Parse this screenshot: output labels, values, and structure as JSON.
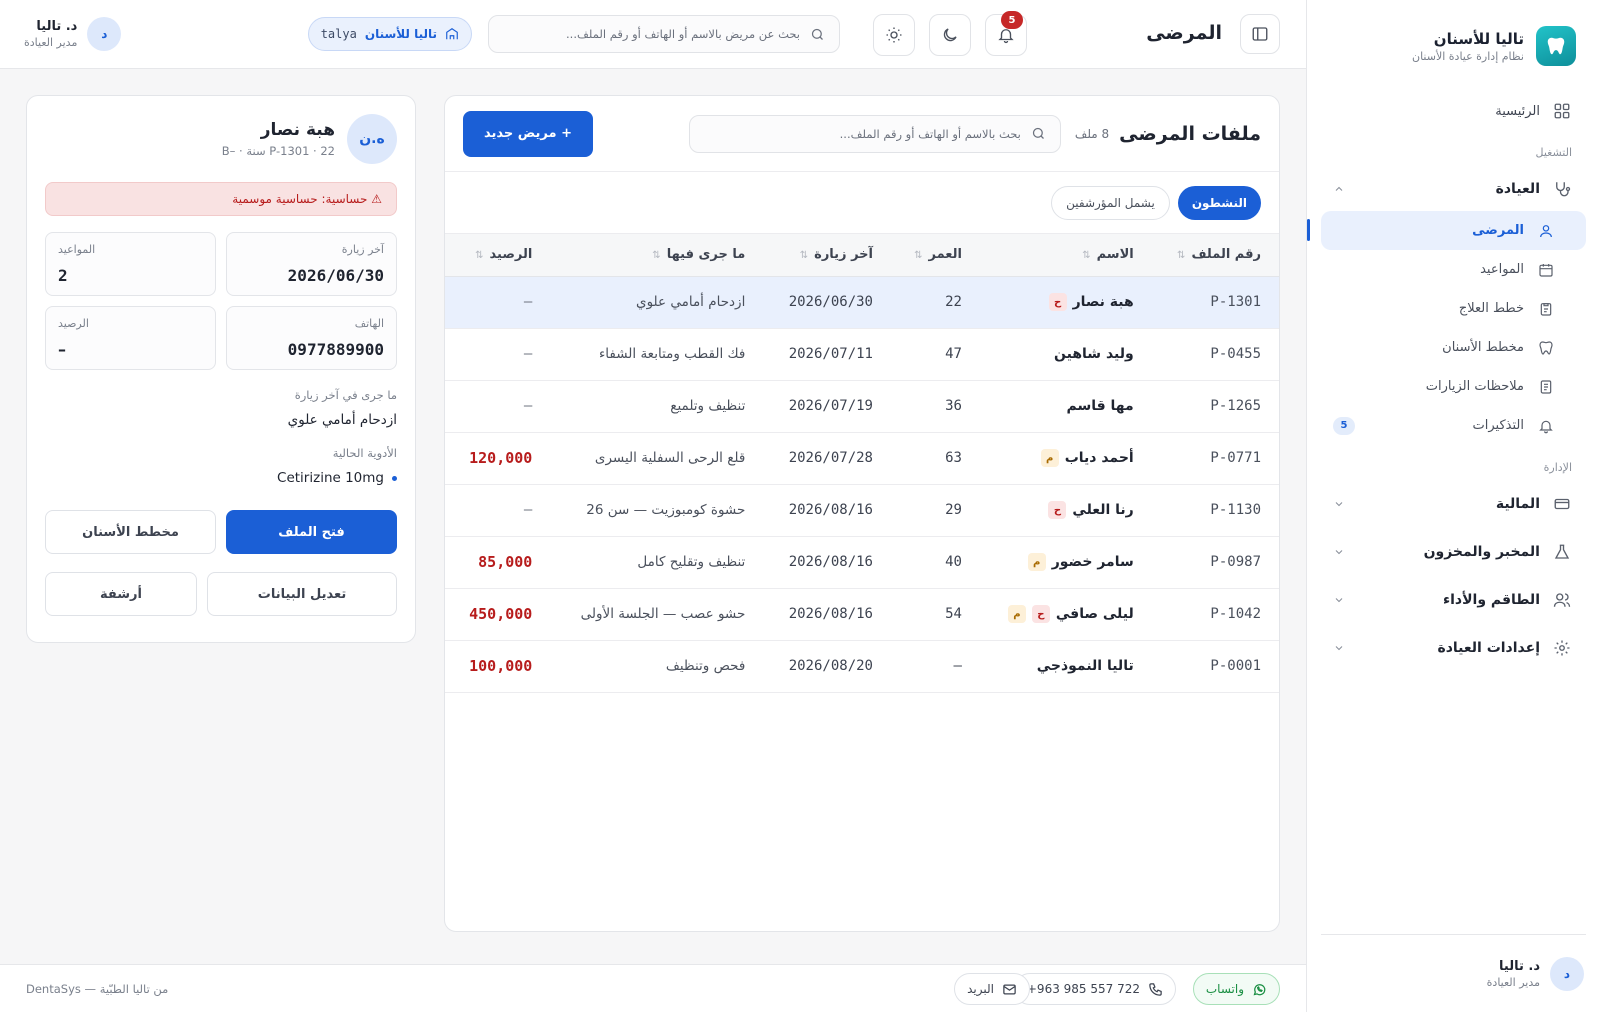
{
  "sidebar": {
    "brand_name": "تاليا للأسنان",
    "brand_sub": "نظام إدارة عيادة الأسنان",
    "home": "الرئيسية",
    "section_ops": "التشغيل",
    "clinic_group": "العيادة",
    "items": [
      {
        "label": "المرضى"
      },
      {
        "label": "المواعيد"
      },
      {
        "label": "خطط العلاج"
      },
      {
        "label": "مخطط الأسنان"
      },
      {
        "label": "ملاحظات الزيارات"
      },
      {
        "label": "التذكيرات",
        "badge": "5"
      }
    ],
    "section_admin": "الإدارة",
    "admin_groups": [
      {
        "label": "المالية"
      },
      {
        "label": "المخبر والمخزون"
      },
      {
        "label": "الطاقم والأداء"
      },
      {
        "label": "إعدادات العيادة"
      }
    ],
    "user": {
      "initial": "د",
      "name": "د. تاليا",
      "role": "مدير العيادة"
    }
  },
  "topbar": {
    "title": "المرضى",
    "search_placeholder": "بحث عن مريض بالاسم أو الهاتف أو رقم الملف...",
    "clinic_name": "تاليا للأسنان",
    "clinic_code": "talya",
    "notif_count": "5",
    "user": {
      "initial": "د",
      "name": "د. تاليا",
      "role": "مدير العيادة"
    }
  },
  "patients": {
    "title": "ملفات المرضى",
    "count": "8 ملف",
    "search_placeholder": "بحث بالاسم أو الهاتف أو رقم الملف...",
    "new_button": "+ مريض جديد",
    "filter_active": "النشطون",
    "filter_archived": "يشمل المؤرشفين",
    "columns": {
      "file": "رقم الملف",
      "name": "الاسم",
      "age": "العمر",
      "last_visit": "آخر زيارة",
      "procedure": "ما جرى فيها",
      "balance": "الرصيد"
    },
    "rows": [
      {
        "file": "P-1301",
        "name": "هبة نصار",
        "tags": [
          {
            "t": "ح",
            "c": "red"
          }
        ],
        "age": "22",
        "last_visit": "2026/06/30",
        "procedure": "ازدحام أمامي علوي",
        "balance": "—"
      },
      {
        "file": "P-0455",
        "name": "وليد شاهين",
        "tags": [],
        "age": "47",
        "last_visit": "2026/07/11",
        "procedure": "فك القطب ومتابعة الشفاء",
        "balance": "—"
      },
      {
        "file": "P-1265",
        "name": "مها قاسم",
        "tags": [],
        "age": "36",
        "last_visit": "2026/07/19",
        "procedure": "تنظيف وتلميع",
        "balance": "—"
      },
      {
        "file": "P-0771",
        "name": "أحمد دياب",
        "tags": [
          {
            "t": "م",
            "c": "amber"
          }
        ],
        "age": "63",
        "last_visit": "2026/07/28",
        "procedure": "قلع الرحى السفلية اليسرى",
        "balance": "120,000"
      },
      {
        "file": "P-1130",
        "name": "رنا العلي",
        "tags": [
          {
            "t": "ح",
            "c": "red"
          }
        ],
        "age": "29",
        "last_visit": "2026/08/16",
        "procedure": "حشوة كومبوزيت — سن 26",
        "balance": "—"
      },
      {
        "file": "P-0987",
        "name": "سامر خضور",
        "tags": [
          {
            "t": "م",
            "c": "amber"
          }
        ],
        "age": "40",
        "last_visit": "2026/08/16",
        "procedure": "تنظيف وتقليح كامل",
        "balance": "85,000"
      },
      {
        "file": "P-1042",
        "name": "ليلى صافي",
        "tags": [
          {
            "t": "ح",
            "c": "red"
          },
          {
            "t": "م",
            "c": "amber"
          }
        ],
        "age": "54",
        "last_visit": "2026/08/16",
        "procedure": "حشو عصب — الجلسة الأولى",
        "balance": "450,000"
      },
      {
        "file": "P-0001",
        "name": "تاليا النموذجي",
        "tags": [],
        "age": "—",
        "last_visit": "2026/08/20",
        "procedure": "فحص وتنظيف",
        "balance": "100,000"
      }
    ]
  },
  "detail": {
    "initials": "ه.ن",
    "name": "هبة نصار",
    "meta": "P-1301 · 22 سنة · –B",
    "alert": "⚠ حساسية: حساسية موسمية",
    "stats": {
      "last_visit_label": "آخر زيارة",
      "last_visit": "2026/06/30",
      "appointments_label": "المواعيد",
      "appointments": "2",
      "phone_label": "الهاتف",
      "phone": "0977889900",
      "balance_label": "الرصيد",
      "balance": "–"
    },
    "last_proc_label": "ما جرى في آخر زيارة",
    "last_proc": "ازدحام أمامي علوي",
    "meds_label": "الأدوية الحالية",
    "med": "Cetirizine 10mg",
    "open_button": "فتح الملف",
    "chart_button": "مخطط الأسنان",
    "edit_button": "تعديل البيانات",
    "xray_button": "أرشفة"
  },
  "footer": {
    "whatsapp": "واتساب",
    "phone": "+963 985 557 722",
    "email": "البريد",
    "copyright": "DentaSys — من تاليا الطبّية"
  },
  "colors": {
    "accent": "#1b5fd6",
    "danger": "#b71c1c",
    "whatsapp": "#1a8f43"
  }
}
